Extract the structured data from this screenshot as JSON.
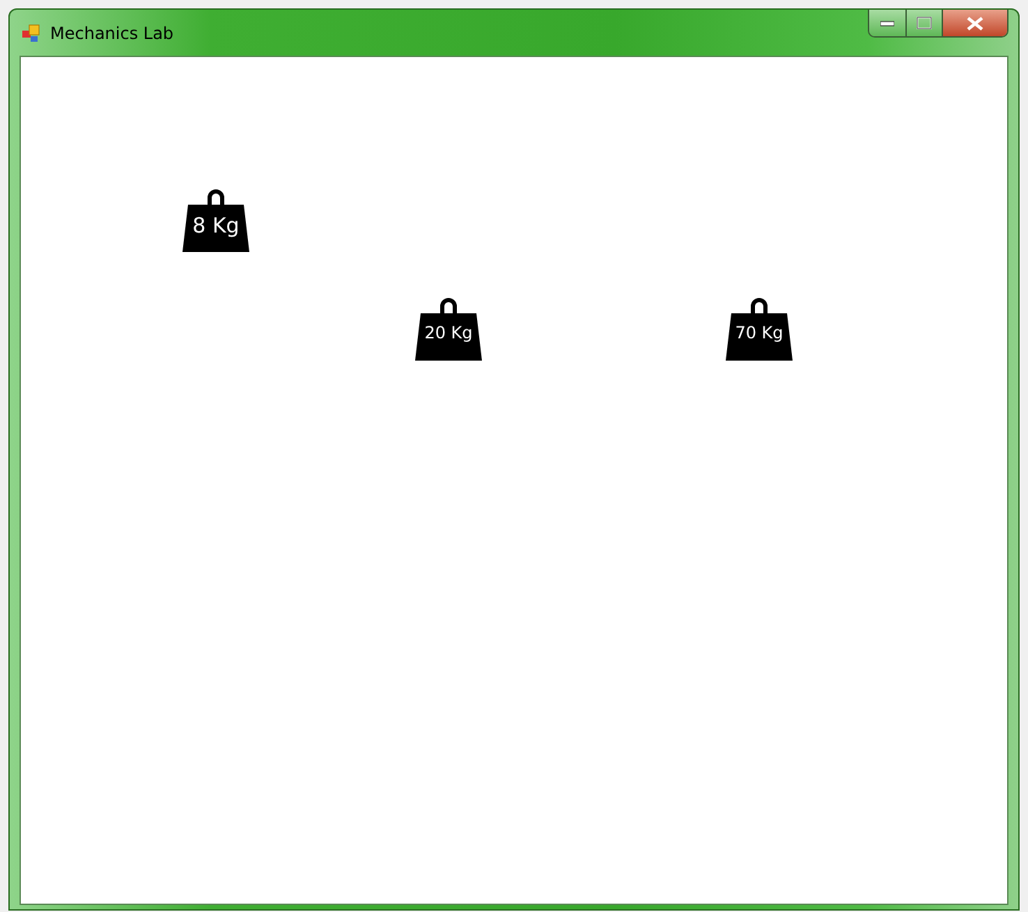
{
  "window": {
    "title": "Mechanics Lab"
  },
  "weights": [
    {
      "label": "8 Kg"
    },
    {
      "label": "20 Kg"
    },
    {
      "label": "70 Kg"
    }
  ]
}
